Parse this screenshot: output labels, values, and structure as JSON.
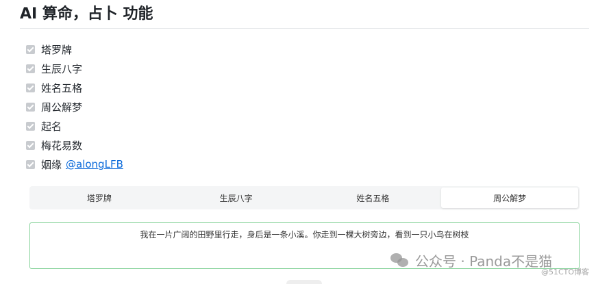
{
  "page_title": "AI 算命，占卜 功能",
  "tasks": [
    {
      "label": "塔罗牌",
      "checked": true
    },
    {
      "label": "生辰八字",
      "checked": true
    },
    {
      "label": "姓名五格",
      "checked": true
    },
    {
      "label": "周公解梦",
      "checked": true
    },
    {
      "label": "起名",
      "checked": true
    },
    {
      "label": "梅花易数",
      "checked": true
    },
    {
      "label": "姻缘",
      "checked": true,
      "mention": "@alongLFB"
    }
  ],
  "tabs": [
    {
      "label": "塔罗牌",
      "active": false
    },
    {
      "label": "生辰八字",
      "active": false
    },
    {
      "label": "姓名五格",
      "active": false
    },
    {
      "label": "周公解梦",
      "active": true
    }
  ],
  "dream_input": {
    "value": "我在一片广阔的田野里行走，身后是一条小溪。你走到一棵大树旁边，看到一只小鸟在树枝"
  },
  "watermark": {
    "text": "公众号 · Panda不是猫",
    "credit": "@51CTO博客"
  },
  "colors": {
    "link": "#0969da",
    "input_border": "#86d29a",
    "tab_bg": "#f4f5f6"
  }
}
